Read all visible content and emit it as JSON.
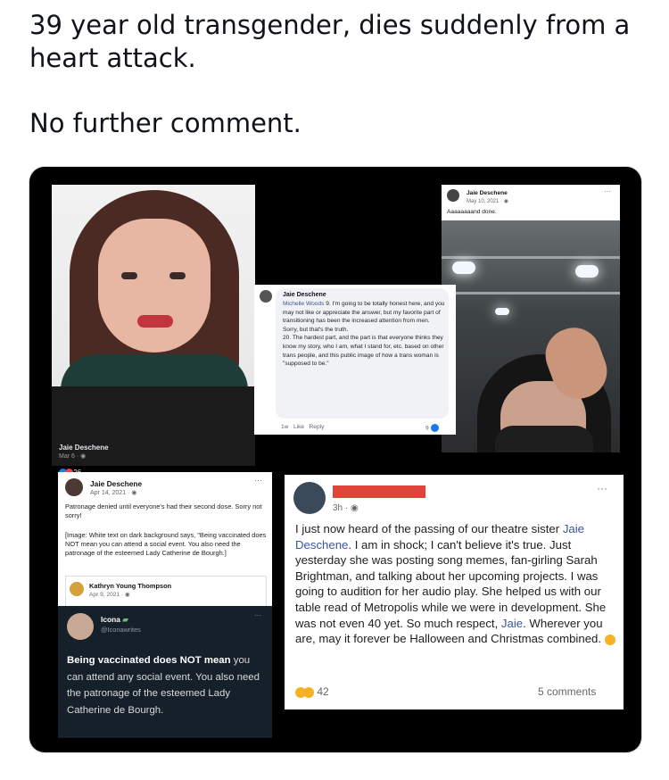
{
  "tweet": {
    "line1": "39 year old transgender, dies suddenly from a heart attack.",
    "line2": "No further comment."
  },
  "post_topleft": {
    "name": "Jaie Deschene",
    "date": "Mar 6 · ",
    "reaction_count": "26"
  },
  "comment_middle": {
    "name": "Jaie Deschene",
    "mention": "Michelle Woods",
    "text": " 9. I'm going to be totally honest here, and you may not like or appreciate the answer, but my favorite part of transitioning has been the increased attention from men. Sorry, but that's the truth.",
    "text2": "20. The hardest part, and the part is that everyone thinks they know my story, who I am, what I stand for, etc. based on other trans people, and this public image of how a trans woman is \"supposed to be.\"",
    "age": "1w",
    "like": "Like",
    "reply": "Reply",
    "count": "9"
  },
  "post_topright": {
    "name": "Jaie Deschene",
    "date": "May 10, 2021 · ",
    "text": "Aaaaaaaand done.",
    "more": "···"
  },
  "post_bottomleft": {
    "name": "Jaie Deschene",
    "date": "Apr 14, 2021 · ",
    "more": "···",
    "text": "Patronage denied until everyone's had their second dose.  Sorry not sorry!",
    "image_desc": "[Image: White text on dark background says, \"Being vaccinated does NOT mean you can attend a social event.  You also need the patronage of the esteemed Lady Catherine de Bourgh.]",
    "shared_name": "Kathryn Young Thompson",
    "shared_date": "Apr 9, 2021 · ",
    "tweet_name": "Icona",
    "tweet_handle": "@Iconawrites",
    "tweet_more": "···",
    "tweet_bold": "Being vaccinated does NOT mean",
    "tweet_rest": "you can attend any social event. You also need the patronage of the esteemed Lady Catherine de Bourgh."
  },
  "post_bottomright": {
    "time": "3h · ",
    "more": "···",
    "body_a": "I just now heard of the passing of our theatre sister ",
    "mention1": "Jaie Deschene",
    "body_b": ". I am in shock; I can't believe it's true. Just yesterday she was posting song memes, fan-girling Sarah Brightman, and talking about her upcoming projects. I was going to audition for her audio play. She helped us with our table read of Metropolis while we were in development. She was not even 40 yet. So much respect, ",
    "mention2": "Jaie",
    "body_c": ". Wherever you are, may it forever be Halloween and Christmas combined.",
    "reaction_count": "42",
    "comments": "5 comments"
  },
  "colors": {
    "link": "#385898",
    "redaction": "#e0453a",
    "twitter_bg": "#15202b"
  }
}
